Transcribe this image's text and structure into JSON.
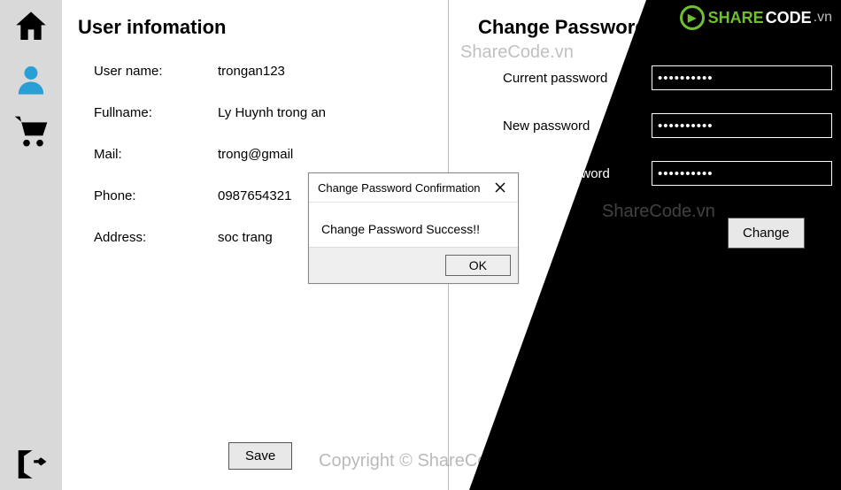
{
  "sidebar": {
    "items": [
      {
        "name": "home-icon"
      },
      {
        "name": "user-icon",
        "active": true
      },
      {
        "name": "cart-icon"
      }
    ],
    "logout": "logout-icon"
  },
  "user_info": {
    "heading": "User infomation",
    "rows": [
      {
        "label": "User name:",
        "value": "trongan123"
      },
      {
        "label": "Fullname:",
        "value": "Ly Huynh trong an"
      },
      {
        "label": "Mail:",
        "value": "trong@gmail"
      },
      {
        "label": "Phone:",
        "value": "0987654321"
      },
      {
        "label": "Address:",
        "value": "soc trang"
      }
    ],
    "save_label": "Save"
  },
  "change_password": {
    "heading": "Change Password",
    "rows": [
      {
        "label": "Current password",
        "value": "●●●●●●●●●●"
      },
      {
        "label": "New password",
        "value": "●●●●●●●●●●"
      },
      {
        "label": "Confirm password",
        "value": "●●●●●●●●●●"
      }
    ],
    "change_label": "Change"
  },
  "dialog": {
    "title": "Change Password Confirmation",
    "message": "Change Password Success!!",
    "ok_label": "OK"
  },
  "watermarks": {
    "top": "ShareCode.vn",
    "right": "ShareCode.vn",
    "bottom": "Copyright © ShareCode.vn"
  },
  "brand": {
    "green": "SHARE",
    "white": "CODE",
    "tld": ".vn"
  }
}
